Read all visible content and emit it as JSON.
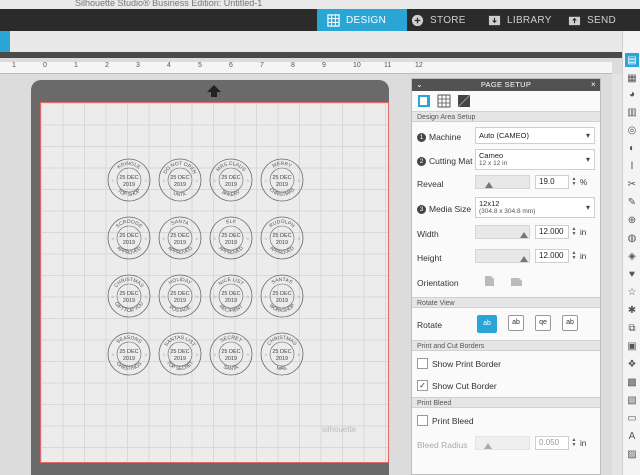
{
  "window": {
    "title": "Silhouette Studio® Business Edition: Untitled-1"
  },
  "nav": {
    "tabs": [
      {
        "label": "DESIGN",
        "icon": "grid-icon",
        "active": true
      },
      {
        "label": "STORE",
        "icon": "store-icon",
        "active": false
      },
      {
        "label": "LIBRARY",
        "icon": "library-icon",
        "active": false
      },
      {
        "label": "SEND",
        "icon": "send-icon",
        "active": false
      }
    ]
  },
  "ruler": {
    "ticks": [
      "1",
      "0",
      "1",
      "2",
      "3",
      "4",
      "5",
      "6",
      "7",
      "8",
      "9",
      "10",
      "11",
      "12"
    ]
  },
  "canvas": {
    "watermark": "silhouette",
    "cut_line_color": "#e06a6a",
    "stamps": [
      {
        "top": "KRINGLE",
        "date": "25 DEC",
        "year": "2019",
        "bottom": "TOP SHOP"
      },
      {
        "top": "DO NOT OPEN",
        "date": "25 DEC",
        "year": "2019",
        "bottom": "UNTIL"
      },
      {
        "top": "MRS.CLAUS",
        "date": "25 DEC",
        "year": "2019",
        "bottom": "BAKERY"
      },
      {
        "top": "MERRY",
        "date": "25 DEC",
        "year": "2019",
        "bottom": "CHRISTMAS"
      },
      {
        "top": "SCROOGE",
        "date": "25 DEC",
        "year": "2019",
        "bottom": "APPROVED"
      },
      {
        "top": "SANTA",
        "date": "25 DEC",
        "year": "2019",
        "bottom": "APPROVED"
      },
      {
        "top": "ELF",
        "date": "25 DEC",
        "year": "2019",
        "bottom": "APPROVED"
      },
      {
        "top": "RUDOLPH",
        "date": "25 DEC",
        "year": "2019",
        "bottom": "APPROVED"
      },
      {
        "top": "CHRISTMAS",
        "date": "25 DEC",
        "year": "2019",
        "bottom": "GIFT FOR YOU"
      },
      {
        "top": "HOLIDAY",
        "date": "25 DEC",
        "year": "2019",
        "bottom": "POSTAGE"
      },
      {
        "top": "NICE LIST",
        "date": "25 DEC",
        "year": "2019",
        "bottom": "RECIPIENT"
      },
      {
        "top": "SANTAS",
        "date": "25 DEC",
        "year": "2019",
        "bottom": "WORKSHOP"
      },
      {
        "top": "SEASONS",
        "date": "25 DEC",
        "year": "2019",
        "bottom": "GREETINGS"
      },
      {
        "top": "SANTAS LIST",
        "date": "25 DEC",
        "year": "2019",
        "bottom": "TOP SECRET"
      },
      {
        "top": "SECRET",
        "date": "25 DEC",
        "year": "2019",
        "bottom": "SANTA"
      },
      {
        "top": "CHRISTMAS",
        "date": "25 DEC",
        "year": "2019",
        "bottom": "MAIL"
      }
    ]
  },
  "panel": {
    "title": "PAGE SETUP",
    "sections": {
      "design_area": "Design Area Setup",
      "rotate_view": "Rotate View",
      "print_cut": "Print and Cut Borders",
      "print_bleed": "Print Bleed"
    },
    "machine": {
      "num": "1",
      "label": "Machine",
      "value": "Auto (CAMEO)"
    },
    "cutting_mat": {
      "num": "2",
      "label": "Cutting Mat",
      "value": "Cameo",
      "sub": "12 x 12 in"
    },
    "reveal": {
      "label": "Reveal",
      "value": "19.0",
      "unit": "%",
      "level": 0.19
    },
    "media_size": {
      "num": "3",
      "label": "Media Size",
      "value": "12x12",
      "sub": "(304.8 x 304.8 mm)"
    },
    "width": {
      "label": "Width",
      "value": "12.000",
      "unit": "in"
    },
    "height": {
      "label": "Height",
      "value": "12.000",
      "unit": "in"
    },
    "orientation": {
      "label": "Orientation"
    },
    "rotate": {
      "label": "Rotate",
      "options": [
        "ab",
        "ab",
        "qe",
        "ab"
      ]
    },
    "show_print_border": {
      "label": "Show Print Border",
      "checked": false
    },
    "show_cut_border": {
      "label": "Show Cut Border",
      "checked": true
    },
    "print_bleed": {
      "label": "Print Bleed",
      "checked": false
    },
    "bleed_radius": {
      "label": "Bleed Radius",
      "value": "0.050",
      "unit": "in"
    }
  },
  "colors": {
    "accent": "#2aa6d6",
    "navbar": "#2b2b2b",
    "panel_header": "#525252"
  }
}
